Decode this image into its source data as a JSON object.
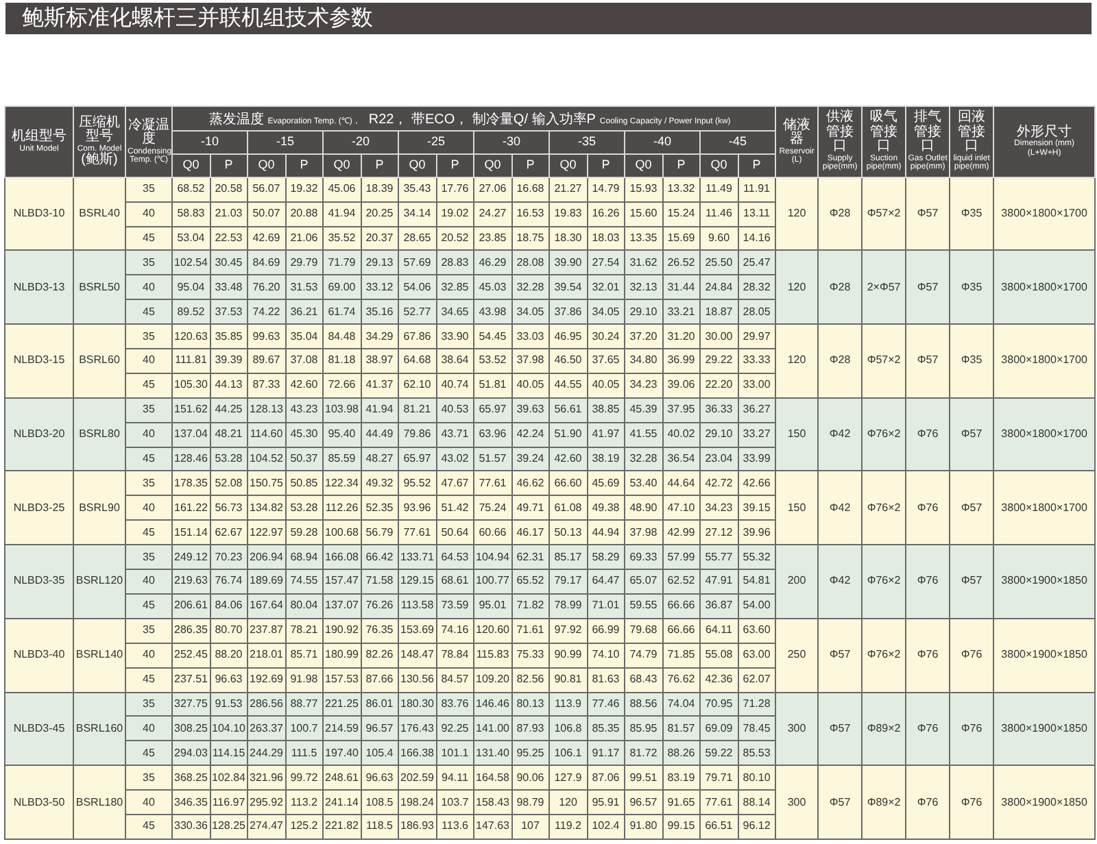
{
  "title": "鲍斯标准化螺杆三并联机组技术参数",
  "table": {
    "left_headers": [
      {
        "lines": [
          {
            "kind": "cn",
            "text": "机组型号"
          },
          {
            "kind": "en",
            "text": "Unit Model"
          }
        ]
      },
      {
        "lines": [
          {
            "kind": "cn",
            "text": "压缩机型号"
          },
          {
            "kind": "en",
            "text": "Com. Model"
          },
          {
            "kind": "cn",
            "text": "(鲍斯)"
          }
        ]
      },
      {
        "lines": [
          {
            "kind": "cn",
            "text": "冷凝温度"
          },
          {
            "kind": "en",
            "text": "Condensing"
          },
          {
            "kind": "en",
            "text": "Temp. (℃)"
          }
        ]
      }
    ],
    "group_header": [
      {
        "kind": "cn",
        "text": "蒸发温度"
      },
      {
        "kind": "en",
        "text": "Evaporation Temp. (℃)，"
      },
      {
        "kind": "cn",
        "text": "R22， 带ECO， 制冷量Q/ 输入功率P"
      },
      {
        "kind": "en",
        "text": "Cooling Capacity / Power Input (kw)"
      }
    ],
    "evaporation_temps": [
      {
        "temp": "-10",
        "sub": [
          "Q0",
          "P"
        ]
      },
      {
        "temp": "-15",
        "sub": [
          "Q0",
          "P"
        ]
      },
      {
        "temp": "-20",
        "sub": [
          "Q0",
          "P"
        ]
      },
      {
        "temp": "-25",
        "sub": [
          "Q0",
          "P"
        ]
      },
      {
        "temp": "-30",
        "sub": [
          "Q0",
          "P"
        ]
      },
      {
        "temp": "-35",
        "sub": [
          "Q0",
          "P"
        ]
      },
      {
        "temp": "-40",
        "sub": [
          "Q0",
          "P"
        ]
      },
      {
        "temp": "-45",
        "sub": [
          "Q0",
          "P"
        ]
      }
    ],
    "right_headers": [
      {
        "lines": [
          {
            "kind": "cn",
            "text": "储液器"
          },
          {
            "kind": "en",
            "text": "Reservoir"
          },
          {
            "kind": "en",
            "text": "(L)"
          }
        ]
      },
      {
        "lines": [
          {
            "kind": "cn",
            "text": "供液管接口"
          },
          {
            "kind": "en",
            "text": "Supply"
          },
          {
            "kind": "en",
            "text": "pipe(mm)"
          }
        ]
      },
      {
        "lines": [
          {
            "kind": "cn",
            "text": "吸气管接口"
          },
          {
            "kind": "en",
            "text": "Suction"
          },
          {
            "kind": "en",
            "text": "pipe(mm)"
          }
        ]
      },
      {
        "lines": [
          {
            "kind": "cn",
            "text": "排气管接口"
          },
          {
            "kind": "en",
            "text": "Gas Outlet"
          },
          {
            "kind": "en",
            "text": "pipe(mm)"
          }
        ]
      },
      {
        "lines": [
          {
            "kind": "cn",
            "text": "回液管接口"
          },
          {
            "kind": "en",
            "text": "liquid inlet"
          },
          {
            "kind": "en",
            "text": "pipe(mm)"
          }
        ]
      },
      {
        "lines": [
          {
            "kind": "cn",
            "text": "外形尺寸"
          },
          {
            "kind": "en",
            "text": "Dimension (mm)"
          },
          {
            "kind": "en",
            "text": "(L+W+H)"
          }
        ]
      }
    ],
    "groups": [
      {
        "unit_model": "NLBD3-10",
        "com_model": "BSRL40",
        "reservoir": "120",
        "supply": "Φ28",
        "suction": "Φ57×2",
        "gas_outlet": "Φ57",
        "liquid_inlet": "Φ35",
        "dimension": "3800×1800×1700",
        "rows": [
          {
            "condensing": "35",
            "values": [
              "68.52",
              "20.58",
              "56.07",
              "19.32",
              "45.06",
              "18.39",
              "35.43",
              "17.76",
              "27.06",
              "16.68",
              "21.27",
              "14.79",
              "15.93",
              "13.32",
              "11.49",
              "11.91"
            ]
          },
          {
            "condensing": "40",
            "values": [
              "58.83",
              "21.03",
              "50.07",
              "20.88",
              "41.94",
              "20.25",
              "34.14",
              "19.02",
              "24.27",
              "16.53",
              "19.83",
              "16.26",
              "15.60",
              "15.24",
              "11.46",
              "13.11"
            ]
          },
          {
            "condensing": "45",
            "values": [
              "53.04",
              "22.53",
              "42.69",
              "21.06",
              "35.52",
              "20.37",
              "28.65",
              "20.52",
              "23.85",
              "18.75",
              "18.30",
              "18.03",
              "13.35",
              "15.69",
              "9.60",
              "14.16"
            ]
          }
        ]
      },
      {
        "unit_model": "NLBD3-13",
        "com_model": "BSRL50",
        "reservoir": "120",
        "supply": "Φ28",
        "suction": "2×Φ57",
        "gas_outlet": "Φ57",
        "liquid_inlet": "Φ35",
        "dimension": "3800×1800×1700",
        "rows": [
          {
            "condensing": "35",
            "values": [
              "102.54",
              "30.45",
              "84.69",
              "29.79",
              "71.79",
              "29.13",
              "57.69",
              "28.83",
              "46.29",
              "28.08",
              "39.90",
              "27.54",
              "31.62",
              "26.52",
              "25.50",
              "25.47"
            ]
          },
          {
            "condensing": "40",
            "values": [
              "95.04",
              "33.48",
              "76.20",
              "31.53",
              "69.00",
              "33.12",
              "54.06",
              "32.85",
              "45.03",
              "32.28",
              "39.54",
              "32.01",
              "32.13",
              "31.44",
              "24.84",
              "28.32"
            ]
          },
          {
            "condensing": "45",
            "values": [
              "89.52",
              "37.53",
              "74.22",
              "36.21",
              "61.74",
              "35.16",
              "52.77",
              "34.65",
              "43.98",
              "34.05",
              "37.86",
              "34.05",
              "29.10",
              "33.21",
              "18.87",
              "28.05"
            ]
          }
        ]
      },
      {
        "unit_model": "NLBD3-15",
        "com_model": "BSRL60",
        "reservoir": "120",
        "supply": "Φ28",
        "suction": "Φ57×2",
        "gas_outlet": "Φ57",
        "liquid_inlet": "Φ35",
        "dimension": "3800×1800×1700",
        "rows": [
          {
            "condensing": "35",
            "values": [
              "120.63",
              "35.85",
              "99.63",
              "35.04",
              "84.48",
              "34.29",
              "67.86",
              "33.90",
              "54.45",
              "33.03",
              "46.95",
              "30.24",
              "37.20",
              "31.20",
              "30.00",
              "29.97"
            ]
          },
          {
            "condensing": "40",
            "values": [
              "111.81",
              "39.39",
              "89.67",
              "37.08",
              "81.18",
              "38.97",
              "64.68",
              "38.64",
              "53.52",
              "37.98",
              "46.50",
              "37.65",
              "34.80",
              "36.99",
              "29.22",
              "33.33"
            ]
          },
          {
            "condensing": "45",
            "values": [
              "105.30",
              "44.13",
              "87.33",
              "42.60",
              "72.66",
              "41.37",
              "62.10",
              "40.74",
              "51.81",
              "40.05",
              "44.55",
              "40.05",
              "34.23",
              "39.06",
              "22.20",
              "33.00"
            ]
          }
        ]
      },
      {
        "unit_model": "NLBD3-20",
        "com_model": "BSRL80",
        "reservoir": "150",
        "supply": "Φ42",
        "suction": "Φ76×2",
        "gas_outlet": "Φ76",
        "liquid_inlet": "Φ57",
        "dimension": "3800×1800×1700",
        "rows": [
          {
            "condensing": "35",
            "values": [
              "151.62",
              "44.25",
              "128.13",
              "43.23",
              "103.98",
              "41.94",
              "81.21",
              "40.53",
              "65.97",
              "39.63",
              "56.61",
              "38.85",
              "45.39",
              "37.95",
              "36.33",
              "36.27"
            ]
          },
          {
            "condensing": "40",
            "values": [
              "137.04",
              "48.21",
              "114.60",
              "45.30",
              "95.40",
              "44.49",
              "79.86",
              "43.71",
              "63.96",
              "42.24",
              "51.90",
              "41.97",
              "41.55",
              "40.02",
              "29.10",
              "33.27"
            ]
          },
          {
            "condensing": "45",
            "values": [
              "128.46",
              "53.28",
              "104.52",
              "50.37",
              "85.59",
              "48.27",
              "65.97",
              "43.02",
              "51.57",
              "39.24",
              "42.60",
              "38.19",
              "32.28",
              "36.54",
              "23.04",
              "33.99"
            ]
          }
        ]
      },
      {
        "unit_model": "NLBD3-25",
        "com_model": "BSRL90",
        "reservoir": "150",
        "supply": "Φ42",
        "suction": "Φ76×2",
        "gas_outlet": "Φ76",
        "liquid_inlet": "Φ57",
        "dimension": "3800×1800×1700",
        "rows": [
          {
            "condensing": "35",
            "values": [
              "178.35",
              "52.08",
              "150.75",
              "50.85",
              "122.34",
              "49.32",
              "95.52",
              "47.67",
              "77.61",
              "46.62",
              "66.60",
              "45.69",
              "53.40",
              "44.64",
              "42.72",
              "42.66"
            ]
          },
          {
            "condensing": "40",
            "values": [
              "161.22",
              "56.73",
              "134.82",
              "53.28",
              "112.26",
              "52.35",
              "93.96",
              "51.42",
              "75.24",
              "49.71",
              "61.08",
              "49.38",
              "48.90",
              "47.10",
              "34.23",
              "39.15"
            ]
          },
          {
            "condensing": "45",
            "values": [
              "151.14",
              "62.67",
              "122.97",
              "59.28",
              "100.68",
              "56.79",
              "77.61",
              "50.64",
              "60.66",
              "46.17",
              "50.13",
              "44.94",
              "37.98",
              "42.99",
              "27.12",
              "39.96"
            ]
          }
        ]
      },
      {
        "unit_model": "NLBD3-35",
        "com_model": "BSRL120",
        "reservoir": "200",
        "supply": "Φ42",
        "suction": "Φ76×2",
        "gas_outlet": "Φ76",
        "liquid_inlet": "Φ57",
        "dimension": "3800×1900×1850",
        "rows": [
          {
            "condensing": "35",
            "values": [
              "249.12",
              "70.23",
              "206.94",
              "68.94",
              "166.08",
              "66.42",
              "133.71",
              "64.53",
              "104.94",
              "62.31",
              "85.17",
              "58.29",
              "69.33",
              "57.99",
              "55.77",
              "55.32"
            ]
          },
          {
            "condensing": "40",
            "values": [
              "219.63",
              "76.74",
              "189.69",
              "74.55",
              "157.47",
              "71.58",
              "129.15",
              "68.61",
              "100.77",
              "65.52",
              "79.17",
              "64.47",
              "65.07",
              "62.52",
              "47.91",
              "54.81"
            ]
          },
          {
            "condensing": "45",
            "values": [
              "206.61",
              "84.06",
              "167.64",
              "80.04",
              "137.07",
              "76.26",
              "113.58",
              "73.59",
              "95.01",
              "71.82",
              "78.99",
              "71.01",
              "59.55",
              "66.66",
              "36.87",
              "54.00"
            ]
          }
        ]
      },
      {
        "unit_model": "NLBD3-40",
        "com_model": "BSRL140",
        "reservoir": "250",
        "supply": "Φ57",
        "suction": "Φ76×2",
        "gas_outlet": "Φ76",
        "liquid_inlet": "Φ76",
        "dimension": "3800×1900×1850",
        "rows": [
          {
            "condensing": "35",
            "values": [
              "286.35",
              "80.70",
              "237.87",
              "78.21",
              "190.92",
              "76.35",
              "153.69",
              "74.16",
              "120.60",
              "71.61",
              "97.92",
              "66.99",
              "79.68",
              "66.66",
              "64.11",
              "63.60"
            ]
          },
          {
            "condensing": "40",
            "values": [
              "252.45",
              "88.20",
              "218.01",
              "85.71",
              "180.99",
              "82.26",
              "148.47",
              "78.84",
              "115.83",
              "75.33",
              "90.99",
              "74.10",
              "74.79",
              "71.85",
              "55.08",
              "63.00"
            ]
          },
          {
            "condensing": "45",
            "values": [
              "237.51",
              "96.63",
              "192.69",
              "91.98",
              "157.53",
              "87.66",
              "130.56",
              "84.57",
              "109.20",
              "82.56",
              "90.81",
              "81.63",
              "68.43",
              "76.62",
              "42.36",
              "62.07"
            ]
          }
        ]
      },
      {
        "unit_model": "NLBD3-45",
        "com_model": "BSRL160",
        "reservoir": "300",
        "supply": "Φ57",
        "suction": "Φ89×2",
        "gas_outlet": "Φ76",
        "liquid_inlet": "Φ76",
        "dimension": "3800×1900×1850",
        "rows": [
          {
            "condensing": "35",
            "values": [
              "327.75",
              "91.53",
              "286.56",
              "88.77",
              "221.25",
              "86.01",
              "180.30",
              "83.76",
              "146.46",
              "80.13",
              "113.9",
              "77.46",
              "88.56",
              "74.04",
              "70.95",
              "71.28"
            ]
          },
          {
            "condensing": "40",
            "values": [
              "308.25",
              "104.10",
              "263.37",
              "100.7",
              "214.59",
              "96.57",
              "176.43",
              "92.25",
              "141.00",
              "87.93",
              "106.8",
              "85.35",
              "85.95",
              "81.57",
              "69.09",
              "78.45"
            ]
          },
          {
            "condensing": "45",
            "values": [
              "294.03",
              "114.15",
              "244.29",
              "111.5",
              "197.40",
              "105.4",
              "166.38",
              "101.1",
              "131.40",
              "95.25",
              "106.1",
              "91.17",
              "81.72",
              "88.26",
              "59.22",
              "85.53"
            ]
          }
        ]
      },
      {
        "unit_model": "NLBD3-50",
        "com_model": "BSRL180",
        "reservoir": "300",
        "supply": "Φ57",
        "suction": "Φ89×2",
        "gas_outlet": "Φ76",
        "liquid_inlet": "Φ76",
        "dimension": "3800×1900×1850",
        "rows": [
          {
            "condensing": "35",
            "values": [
              "368.25",
              "102.84",
              "321.96",
              "99.72",
              "248.61",
              "96.63",
              "202.59",
              "94.11",
              "164.58",
              "90.06",
              "127.9",
              "87.06",
              "99.51",
              "83.19",
              "79.71",
              "80.10"
            ]
          },
          {
            "condensing": "40",
            "values": [
              "346.35",
              "116.97",
              "295.92",
              "113.2",
              "241.14",
              "108.5",
              "198.24",
              "103.7",
              "158.43",
              "98.79",
              "120",
              "95.91",
              "96.57",
              "91.65",
              "77.61",
              "88.14"
            ]
          },
          {
            "condensing": "45",
            "values": [
              "330.36",
              "128.25",
              "274.47",
              "125.2",
              "221.82",
              "118.5",
              "186.93",
              "113.6",
              "147.63",
              "107",
              "119.2",
              "102.4",
              "91.80",
              "99.15",
              "66.51",
              "96.12"
            ]
          }
        ]
      }
    ]
  }
}
